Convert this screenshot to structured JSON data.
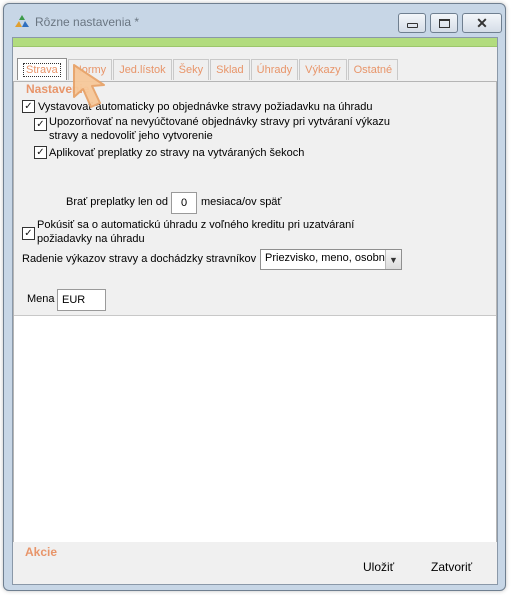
{
  "window": {
    "title": "Rôzne nastavenia *",
    "app_icon": "recycle-triangle-icon",
    "minimize_icon": "minimize-icon",
    "maximize_icon": "maximize-icon",
    "close_icon": "close-icon"
  },
  "tabs": [
    {
      "label": "Strava",
      "active": true
    },
    {
      "label": "Normy",
      "active": false
    },
    {
      "label": "Jed.lístok",
      "active": false
    },
    {
      "label": "Šeky",
      "active": false
    },
    {
      "label": "Sklad",
      "active": false
    },
    {
      "label": "Úhrady",
      "active": false
    },
    {
      "label": "Výkazy",
      "active": false
    },
    {
      "label": "Ostatné",
      "active": false
    }
  ],
  "settings": {
    "section_title": "Nastavenie",
    "opt1": {
      "label": "Vystavovať automaticky po objednávke stravy požiadavku na úhradu",
      "checked": true
    },
    "opt2": {
      "label_line1": "Upozorňovať na nevyúčtované objednávky stravy pri vytváraní výkazu",
      "label_line2": "stravy a nedovoliť jeho vytvorenie",
      "checked": true
    },
    "opt3": {
      "label": "Aplikovať preplatky zo stravy na vytváraných šekoch",
      "checked": true
    },
    "overpay": {
      "label_before": "Brať preplatky len od",
      "value": "0",
      "label_after": "mesiaca/ov späť"
    },
    "opt4": {
      "label_line1": "Pokúsiť sa o automatickú úhradu z voľného kreditu pri uzatváraní",
      "label_line2": "požiadavky na úhradu",
      "checked": true
    },
    "sort": {
      "label": "Radenie výkazov stravy a dochádzky stravníkov",
      "value": "Priezvisko, meno, osobn"
    },
    "currency": {
      "label": "Mena",
      "value": "EUR"
    }
  },
  "actions": {
    "title": "Akcie",
    "save_label": "Uložiť",
    "close_label": "Zatvoriť"
  },
  "colors": {
    "accent": "#e8956a",
    "green_strip": "#b2dc7e",
    "window_frame": "#c7d6e6",
    "cursor": "#f4b27a"
  }
}
